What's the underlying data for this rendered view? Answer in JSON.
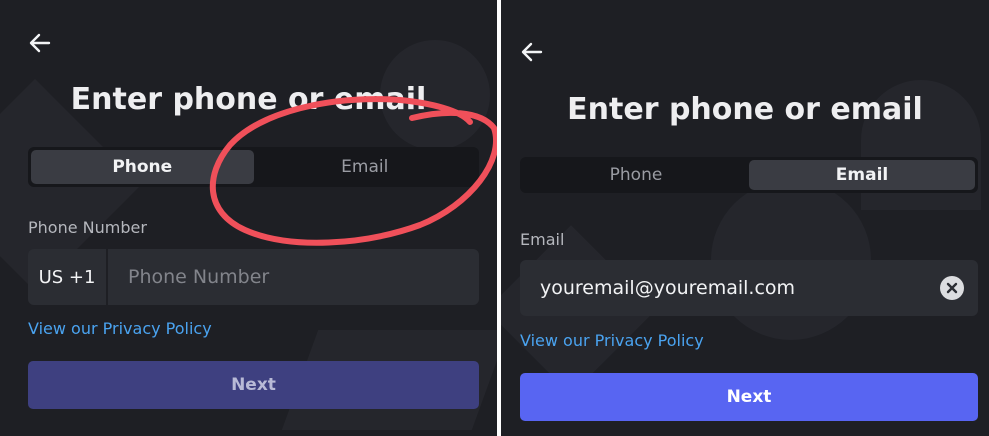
{
  "left_screen": {
    "title": "Enter phone or email",
    "tabs": [
      {
        "label": "Phone",
        "active": true
      },
      {
        "label": "Email",
        "active": false
      }
    ],
    "field_label": "Phone Number",
    "country_code": "US +1",
    "input_value": "",
    "input_placeholder": "Phone Number",
    "privacy_link": "View our Privacy Policy",
    "next_label": "Next",
    "next_enabled": false
  },
  "right_screen": {
    "title": "Enter phone or email",
    "tabs": [
      {
        "label": "Phone",
        "active": false
      },
      {
        "label": "Email",
        "active": true
      }
    ],
    "field_label": "Email",
    "input_value": "youremail@youremail.com",
    "privacy_link": "View our Privacy Policy",
    "next_label": "Next",
    "next_enabled": true
  },
  "icons": {
    "back": "arrow-left-icon",
    "clear": "clear-circle-x-icon"
  },
  "colors": {
    "background": "#1e1f24",
    "accent": "#5865f2",
    "accent_disabled": "#3e4080",
    "link": "#4aa3f0",
    "annotation": "#f0505a"
  }
}
